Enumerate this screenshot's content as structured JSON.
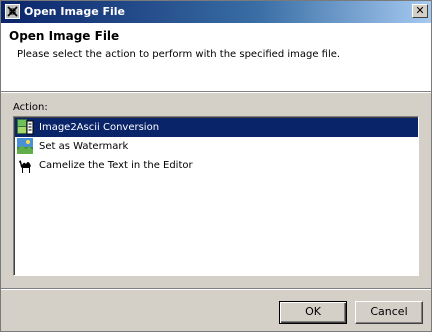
{
  "window": {
    "title": "Open Image File"
  },
  "banner": {
    "title": "Open Image File",
    "message": "Please select the action to perform with the specified image file."
  },
  "actions": {
    "label": "Action:",
    "items": [
      {
        "label": "Image2Ascii Conversion",
        "icon": "image2ascii-icon",
        "selected": true
      },
      {
        "label": "Set as Watermark",
        "icon": "watermark-icon",
        "selected": false
      },
      {
        "label": "Camelize the Text in the Editor",
        "icon": "camel-icon",
        "selected": false
      }
    ]
  },
  "buttons": {
    "ok": "OK",
    "cancel": "Cancel"
  },
  "colors": {
    "selection": "#0a246a",
    "dialog_bg": "#d4d0c8"
  }
}
